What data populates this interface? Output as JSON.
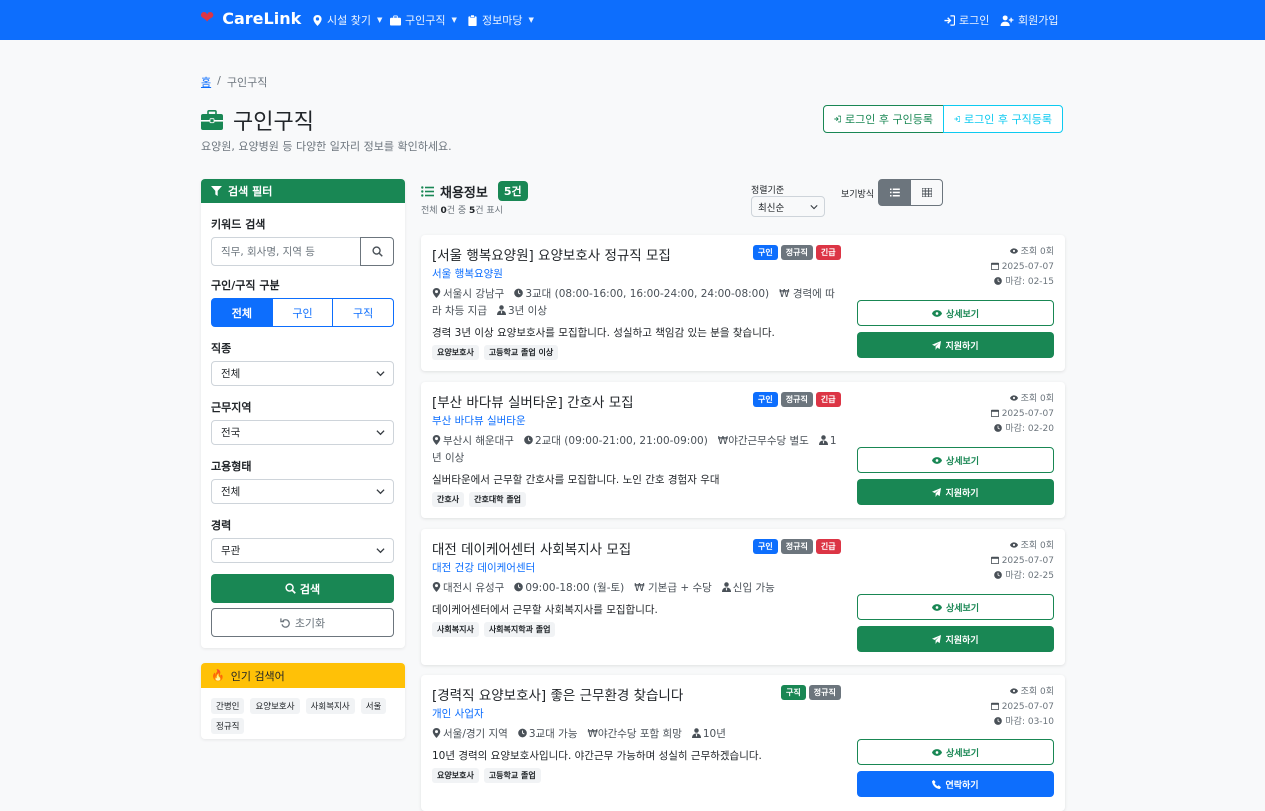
{
  "nav": {
    "brand": "CareLink",
    "items": [
      "시설 찾기",
      "구인구직",
      "정보마당"
    ],
    "login": "로그인",
    "signup": "회원가입"
  },
  "breadcrumb": {
    "home": "홈",
    "current": "구인구직"
  },
  "page": {
    "title": "구인구직",
    "subtitle": "요양원, 요양병원 등 다양한 일자리 정보를 확인하세요.",
    "btn_job_post": "로그인 후 구인등록",
    "btn_seek_post": "로그인 후 구직등록"
  },
  "filter": {
    "header": "검색 필터",
    "keyword_label": "키워드 검색",
    "keyword_placeholder": "직무, 회사명, 지역 등",
    "type_label": "구인/구직 구분",
    "type_options": [
      "전체",
      "구인",
      "구직"
    ],
    "job_label": "직종",
    "job_value": "전체",
    "region_label": "근무지역",
    "region_value": "전국",
    "employ_label": "고용형태",
    "employ_value": "전체",
    "career_label": "경력",
    "career_value": "무관",
    "search_btn": "검색",
    "reset_btn": "초기화"
  },
  "popular": {
    "header": "인기 검색어",
    "tags": [
      "간병인",
      "요양보호사",
      "사회복지사",
      "서울",
      "정규직"
    ]
  },
  "list": {
    "title": "채용정보",
    "count": "5건",
    "summary_prefix": "전체",
    "summary_total": "0",
    "summary_mid": "건 중",
    "summary_shown": "5",
    "summary_suffix": "건 표시",
    "sort_label": "정렬기준",
    "sort_value": "최신순",
    "view_label": "보기방식"
  },
  "jobs": [
    {
      "title": "[서울 행복요양원] 요양보호사 정규직 모집",
      "badges": [
        "구인",
        "정규직",
        "긴급"
      ],
      "company": "서울 행복요양원",
      "location": "서울시 강남구",
      "schedule": "3교대 (08:00-16:00, 16:00-24:00, 24:00-08:00)",
      "pay": "경력에 따라 차등 지급",
      "career": "3년 이상",
      "desc": "경력 3년 이상 요양보호사를 모집합니다. 성실하고 책임감 있는 분을 찾습니다.",
      "tags": [
        "요양보호사",
        "고등학교 졸업 이상"
      ],
      "views": "조회 0회",
      "date": "2025-07-07",
      "deadline": "마감: 02-15",
      "detail_btn": "상세보기",
      "action_btn": "지원하기"
    },
    {
      "title": "[부산 바다뷰 실버타운] 간호사 모집",
      "badges": [
        "구인",
        "정규직",
        "긴급"
      ],
      "company": "부산 바다뷰 실버타운",
      "location": "부산시 해운대구",
      "schedule": "2교대 (09:00-21:00, 21:00-09:00)",
      "pay": "야간근무수당 별도",
      "career": "1년 이상",
      "desc": "실버타운에서 근무할 간호사를 모집합니다. 노인 간호 경험자 우대",
      "tags": [
        "간호사",
        "간호대학 졸업"
      ],
      "views": "조회 0회",
      "date": "2025-07-07",
      "deadline": "마감: 02-20",
      "detail_btn": "상세보기",
      "action_btn": "지원하기"
    },
    {
      "title": "대전 데이케어센터 사회복지사 모집",
      "badges": [
        "구인",
        "정규직",
        "긴급"
      ],
      "company": "대전 건강 데이케어센터",
      "location": "대전시 유성구",
      "schedule": "09:00-18:00 (월-토)",
      "pay": "기본급 + 수당",
      "career": "신입 가능",
      "desc": "데이케어센터에서 근무할 사회복지사를 모집합니다.",
      "tags": [
        "사회복지사",
        "사회복지학과 졸업"
      ],
      "views": "조회 0회",
      "date": "2025-07-07",
      "deadline": "마감: 02-25",
      "detail_btn": "상세보기",
      "action_btn": "지원하기"
    },
    {
      "title": "[경력직 요양보호사] 좋은 근무환경 찾습니다",
      "badges": [
        "구직",
        "정규직"
      ],
      "company": "개인 사업자",
      "location": "서울/경기 지역",
      "schedule": "3교대 가능",
      "pay": "야간수당 포함 희망",
      "career": "10년",
      "desc": "10년 경력의 요양보호사입니다. 야간근무 가능하며 성실히 근무하겠습니다.",
      "tags": [
        "요양보호사",
        "고등학교 졸업"
      ],
      "views": "조회 0회",
      "date": "2025-07-07",
      "deadline": "마감: 03-10",
      "detail_btn": "상세보기",
      "action_btn": "연락하기"
    }
  ],
  "colors": {
    "primary": "#0d6efd",
    "success": "#198754",
    "danger": "#dc3545",
    "warning": "#ffc107",
    "secondary": "#6c757d",
    "info": "#0dcaf0"
  }
}
